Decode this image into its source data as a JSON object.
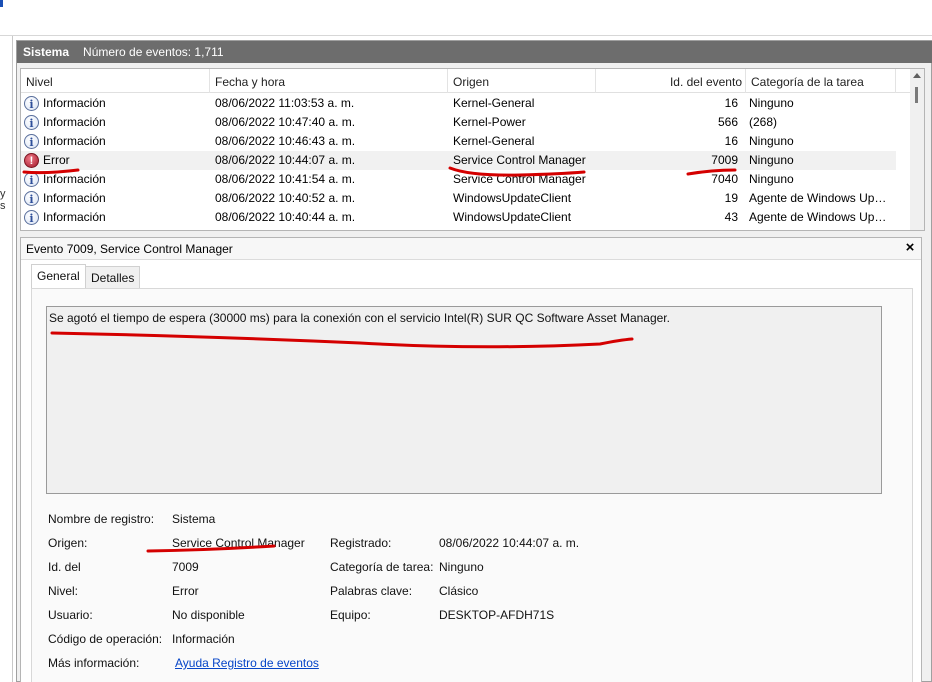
{
  "left_fragment": "y s",
  "header": {
    "log_name": "Sistema",
    "event_count_label": "Número de eventos: 1,711"
  },
  "grid": {
    "columns": [
      "Nivel",
      "Fecha y hora",
      "Origen",
      "Id. del evento",
      "Categoría de la tarea"
    ],
    "rows": [
      {
        "level": "Información",
        "icon": "info-icon",
        "datetime": "08/06/2022 11:03:53 a. m.",
        "source": "Kernel-General",
        "event_id": "16",
        "category": "Ninguno"
      },
      {
        "level": "Información",
        "icon": "info-icon",
        "datetime": "08/06/2022 10:47:40 a. m.",
        "source": "Kernel-Power",
        "event_id": "566",
        "category": "(268)"
      },
      {
        "level": "Información",
        "icon": "info-icon",
        "datetime": "08/06/2022 10:46:43 a. m.",
        "source": "Kernel-General",
        "event_id": "16",
        "category": "Ninguno"
      },
      {
        "level": "Error",
        "icon": "error-icon",
        "datetime": "08/06/2022 10:44:07 a. m.",
        "source": "Service Control Manager",
        "event_id": "7009",
        "category": "Ninguno",
        "selected": true
      },
      {
        "level": "Información",
        "icon": "info-icon",
        "datetime": "08/06/2022 10:41:54 a. m.",
        "source": "Service Control Manager",
        "event_id": "7040",
        "category": "Ninguno"
      },
      {
        "level": "Información",
        "icon": "info-icon",
        "datetime": "08/06/2022 10:40:52 a. m.",
        "source": "WindowsUpdateClient",
        "event_id": "19",
        "category": "Agente de Windows Up…"
      },
      {
        "level": "Información",
        "icon": "info-icon",
        "datetime": "08/06/2022 10:40:44 a. m.",
        "source": "WindowsUpdateClient",
        "event_id": "43",
        "category": "Agente de Windows Up…"
      }
    ]
  },
  "detail": {
    "title": "Evento 7009, Service Control Manager",
    "close_glyph": "×",
    "tabs": [
      "General",
      "Detalles"
    ],
    "message": "Se agotó el tiempo de espera (30000 ms) para la conexión con el servicio Intel(R) SUR QC Software Asset Manager.",
    "props": {
      "log_label": "Nombre de registro:",
      "log_value": "Sistema",
      "source_label": "Origen:",
      "source_value": "Service Control Manager",
      "id_label": "Id. del",
      "id_value": "7009",
      "level_label": "Nivel:",
      "level_value": "Error",
      "user_label": "Usuario:",
      "user_value": "No disponible",
      "opcode_label": "Código de operación:",
      "opcode_value": "Información",
      "more_label": "Más información:",
      "more_link": "Ayuda Registro de eventos",
      "logged_label": "Registrado:",
      "logged_value": "08/06/2022 10:44:07 a. m.",
      "task_label": "Categoría de tarea:",
      "task_value": "Ninguno",
      "keywords_label": "Palabras clave:",
      "keywords_value": "Clásico",
      "computer_label": "Equipo:",
      "computer_value": "DESKTOP-AFDH71S"
    }
  },
  "colors": {
    "annotation": "#d40000",
    "header_bg": "#6d6d6d",
    "link": "#0645c8",
    "error_icon": "#a11628"
  }
}
